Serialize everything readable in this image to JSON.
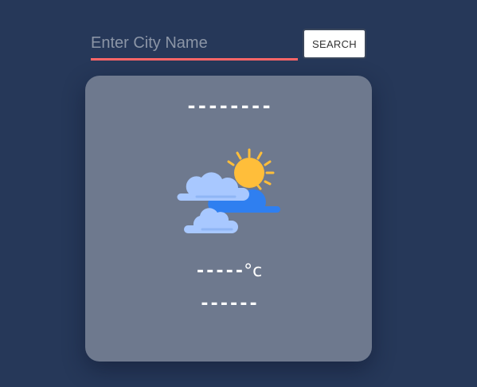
{
  "search": {
    "placeholder": "Enter City Name",
    "value": "",
    "button_label": "SEARCH"
  },
  "card": {
    "city": "--------",
    "temperature": "-----",
    "unit": "°c",
    "description": "------",
    "icon": "sun-behind-clouds-icon"
  },
  "colors": {
    "background": "#263859",
    "card": "#6e798e",
    "input_underline": "#ff6768",
    "sun": "#ffbe3a",
    "cloud_dark": "#2f7ff0",
    "cloud_light": "#a8c8ff"
  }
}
